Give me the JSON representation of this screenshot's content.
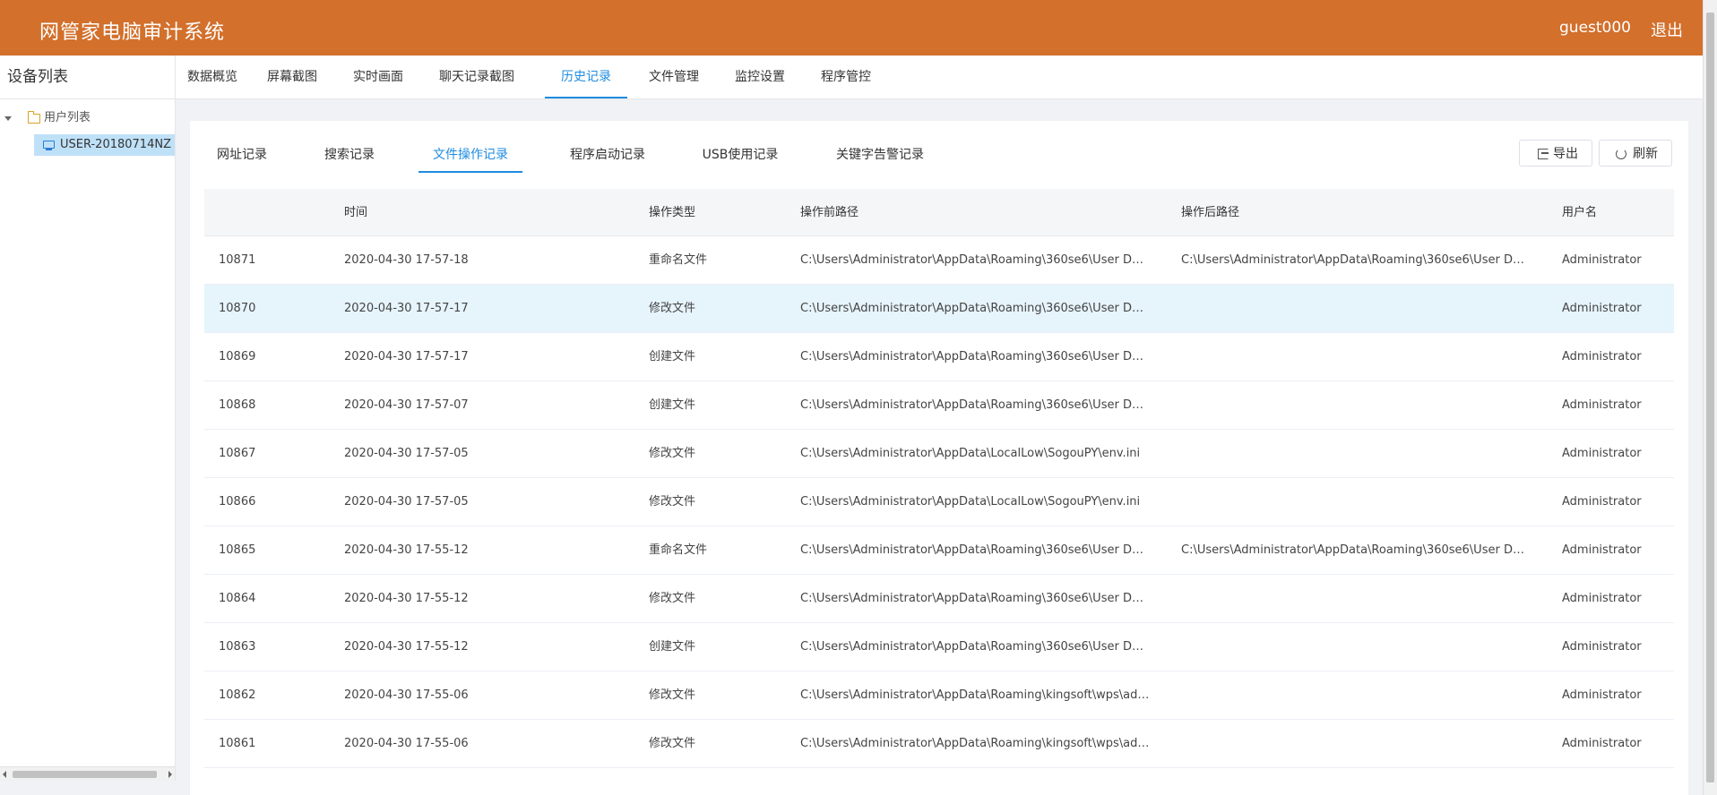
{
  "header": {
    "app_title": "网管家电脑审计系统",
    "username": "guest000",
    "logout_label": "退出",
    "brand_color": "#d2702c"
  },
  "sidebar": {
    "title": "设备列表",
    "tree_root_label": "用户列表",
    "tree_node_label": "USER-20180714NZ"
  },
  "main_tabs": [
    {
      "label": "数据概览"
    },
    {
      "label": "屏幕截图"
    },
    {
      "label": "实时画面"
    },
    {
      "label": "聊天记录截图"
    },
    {
      "label": "历史记录"
    },
    {
      "label": "文件管理"
    },
    {
      "label": "监控设置"
    },
    {
      "label": "程序管控"
    }
  ],
  "sub_tabs": [
    {
      "label": "网址记录"
    },
    {
      "label": "搜索记录"
    },
    {
      "label": "文件操作记录"
    },
    {
      "label": "程序启动记录"
    },
    {
      "label": "USB使用记录"
    },
    {
      "label": "关键字告警记录"
    }
  ],
  "toolbar": {
    "export_label": "导出",
    "refresh_label": "刷新"
  },
  "table": {
    "columns": {
      "id": "",
      "time": "时间",
      "type": "操作类型",
      "before": "操作前路径",
      "after": "操作后路径",
      "user": "用户名"
    },
    "rows": [
      {
        "id": "10871",
        "time": "2020-04-30 17-57-18",
        "type": "重命名文件",
        "before": "C:\\Users\\Administrator\\AppData\\Roaming\\360se6\\User Dat...",
        "after": "C:\\Users\\Administrator\\AppData\\Roaming\\360se6\\User Dat...",
        "user": "Administrator"
      },
      {
        "id": "10870",
        "time": "2020-04-30 17-57-17",
        "type": "修改文件",
        "before": "C:\\Users\\Administrator\\AppData\\Roaming\\360se6\\User Dat...",
        "after": "",
        "user": "Administrator"
      },
      {
        "id": "10869",
        "time": "2020-04-30 17-57-17",
        "type": "创建文件",
        "before": "C:\\Users\\Administrator\\AppData\\Roaming\\360se6\\User Dat...",
        "after": "",
        "user": "Administrator"
      },
      {
        "id": "10868",
        "time": "2020-04-30 17-57-07",
        "type": "创建文件",
        "before": "C:\\Users\\Administrator\\AppData\\Roaming\\360se6\\User Dat...",
        "after": "",
        "user": "Administrator"
      },
      {
        "id": "10867",
        "time": "2020-04-30 17-57-05",
        "type": "修改文件",
        "before": "C:\\Users\\Administrator\\AppData\\LocalLow\\SogouPY\\env.ini",
        "after": "",
        "user": "Administrator"
      },
      {
        "id": "10866",
        "time": "2020-04-30 17-57-05",
        "type": "修改文件",
        "before": "C:\\Users\\Administrator\\AppData\\LocalLow\\SogouPY\\env.ini",
        "after": "",
        "user": "Administrator"
      },
      {
        "id": "10865",
        "time": "2020-04-30 17-55-12",
        "type": "重命名文件",
        "before": "C:\\Users\\Administrator\\AppData\\Roaming\\360se6\\User Dat...",
        "after": "C:\\Users\\Administrator\\AppData\\Roaming\\360se6\\User Dat...",
        "user": "Administrator"
      },
      {
        "id": "10864",
        "time": "2020-04-30 17-55-12",
        "type": "修改文件",
        "before": "C:\\Users\\Administrator\\AppData\\Roaming\\360se6\\User Dat...",
        "after": "",
        "user": "Administrator"
      },
      {
        "id": "10863",
        "time": "2020-04-30 17-55-12",
        "type": "创建文件",
        "before": "C:\\Users\\Administrator\\AppData\\Roaming\\360se6\\User Dat...",
        "after": "",
        "user": "Administrator"
      },
      {
        "id": "10862",
        "time": "2020-04-30 17-55-06",
        "type": "修改文件",
        "before": "C:\\Users\\Administrator\\AppData\\Roaming\\kingsoft\\wps\\add...",
        "after": "",
        "user": "Administrator"
      },
      {
        "id": "10861",
        "time": "2020-04-30 17-55-06",
        "type": "修改文件",
        "before": "C:\\Users\\Administrator\\AppData\\Roaming\\kingsoft\\wps\\add...",
        "after": "",
        "user": "Administrator"
      }
    ]
  }
}
